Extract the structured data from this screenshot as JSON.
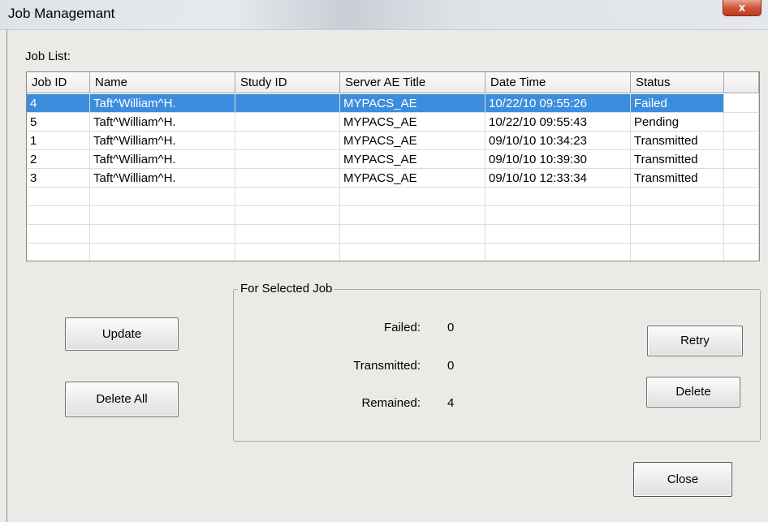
{
  "window": {
    "title": "Job Managemant",
    "close_glyph": "x"
  },
  "job_list": {
    "label": "Job List:",
    "columns": [
      "Job ID",
      "Name",
      "Study ID",
      "Server AE Title",
      "Date Time",
      "Status"
    ],
    "rows": [
      {
        "job_id": "4",
        "name": "Taft^William^H.",
        "study_id": "",
        "server_ae_title": "MYPACS_AE",
        "date_time": "10/22/10 09:55:26",
        "status": "Failed",
        "selected": true
      },
      {
        "job_id": "5",
        "name": "Taft^William^H.",
        "study_id": "",
        "server_ae_title": "MYPACS_AE",
        "date_time": "10/22/10 09:55:43",
        "status": "Pending",
        "selected": false
      },
      {
        "job_id": "1",
        "name": "Taft^William^H.",
        "study_id": "",
        "server_ae_title": "MYPACS_AE",
        "date_time": "09/10/10 10:34:23",
        "status": "Transmitted",
        "selected": false
      },
      {
        "job_id": "2",
        "name": "Taft^William^H.",
        "study_id": "",
        "server_ae_title": "MYPACS_AE",
        "date_time": "09/10/10 10:39:30",
        "status": "Transmitted",
        "selected": false
      },
      {
        "job_id": "3",
        "name": "Taft^William^H.",
        "study_id": "",
        "server_ae_title": "MYPACS_AE",
        "date_time": "09/10/10 12:33:34",
        "status": "Transmitted",
        "selected": false
      }
    ]
  },
  "buttons": {
    "update": "Update",
    "delete_all": "Delete All",
    "retry": "Retry",
    "delete": "Delete",
    "close": "Close"
  },
  "selected_job": {
    "legend": "For Selected Job",
    "failed_label": "Failed:",
    "failed_value": "0",
    "transmitted_label": "Transmitted:",
    "transmitted_value": "0",
    "remained_label": "Remained:",
    "remained_value": "4"
  },
  "colors": {
    "selection": "#3c8ddd",
    "dialog_background": "#ebeae6"
  }
}
